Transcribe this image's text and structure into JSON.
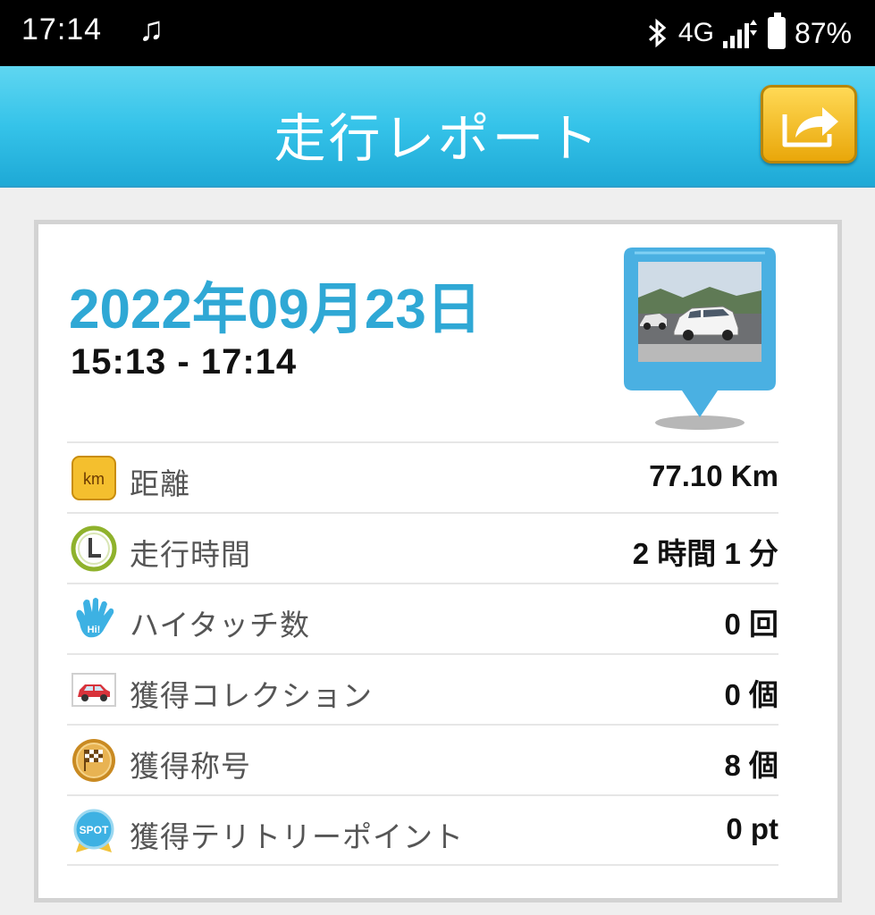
{
  "status_bar": {
    "time": "17:14",
    "network": "4G",
    "battery": "87%"
  },
  "header": {
    "title": "走行レポート"
  },
  "report": {
    "date": "2022年09月23日",
    "time_range": "15:13 - 17:14"
  },
  "stats": [
    {
      "icon": "km-icon",
      "label": "距離",
      "value": "77.10 Km"
    },
    {
      "icon": "clock-icon",
      "label": "走行時間",
      "value": "2 時間 1 分"
    },
    {
      "icon": "high-five-icon",
      "label": "ハイタッチ数",
      "value": "0 回"
    },
    {
      "icon": "car-icon",
      "label": "獲得コレクション",
      "value": "0 個"
    },
    {
      "icon": "medal-icon",
      "label": "獲得称号",
      "value": "8 個"
    },
    {
      "icon": "spot-icon",
      "label": "獲得テリトリーポイント",
      "value": "0 pt"
    }
  ],
  "icon_text": {
    "km": "km",
    "spot": "SPOT",
    "hi": "Hi!"
  },
  "colors": {
    "header": "#35c3e9",
    "date": "#2fa8d5",
    "share_button": "#f2c12e",
    "pin": "#4ab0e2"
  }
}
